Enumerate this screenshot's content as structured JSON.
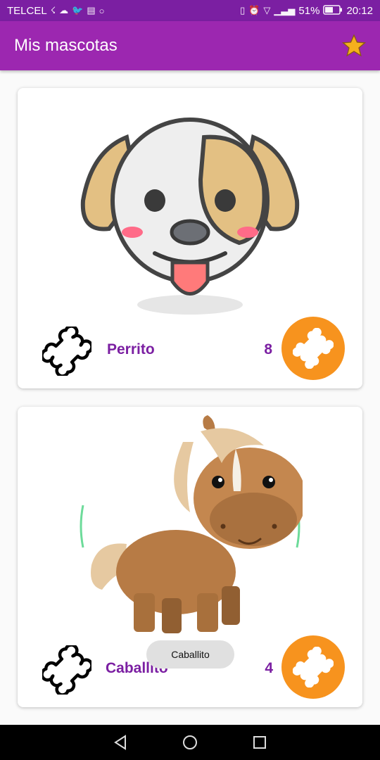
{
  "status_bar": {
    "carrier": "TELCEL",
    "battery": "51%",
    "time": "20:12"
  },
  "app_bar": {
    "title": "Mis mascotas",
    "star_icon": "star-icon"
  },
  "pets": [
    {
      "name": "Perrito",
      "count": "8",
      "image": "dog-image"
    },
    {
      "name": "Caballito",
      "count": "4",
      "image": "horse-image"
    }
  ],
  "toast": {
    "text": "Caballito"
  },
  "colors": {
    "primary": "#9c27b0",
    "primary_dark": "#7b1fa2",
    "accent": "#f7931e"
  }
}
